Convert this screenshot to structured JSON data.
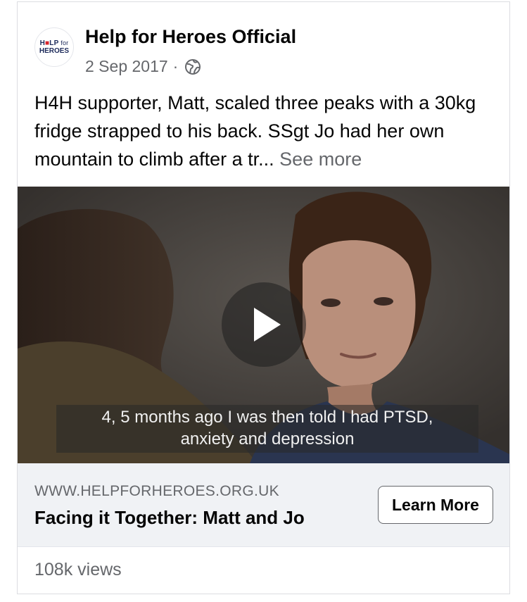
{
  "post": {
    "page_name": "Help for Heroes Official",
    "date": "2 Sep 2017",
    "separator": "·",
    "audience_icon": "globe-icon",
    "text": "H4H supporter, Matt, scaled three peaks with a 30kg fridge strapped to his back. SSgt Jo had her own mountain to climb after a tr...",
    "see_more": "See more"
  },
  "avatar_logo": {
    "line1_a": "H",
    "line1_red": "■",
    "line1_b": "LP",
    "line1_for": "for",
    "line2": "HEROES"
  },
  "video": {
    "play_icon": "play-icon",
    "caption_line1": "4, 5 months ago I was then told I had PTSD,",
    "caption_line2": "anxiety and depression"
  },
  "link": {
    "domain": "WWW.HELPFORHEROES.ORG.UK",
    "title": "Facing it Together: Matt and Jo",
    "cta_label": "Learn More"
  },
  "stats": {
    "views": "108k views"
  },
  "colors": {
    "secondary_text": "#65676b",
    "link_bar_bg": "#f0f2f5",
    "brand_navy": "#1c2a5a",
    "brand_red": "#d8232a"
  }
}
